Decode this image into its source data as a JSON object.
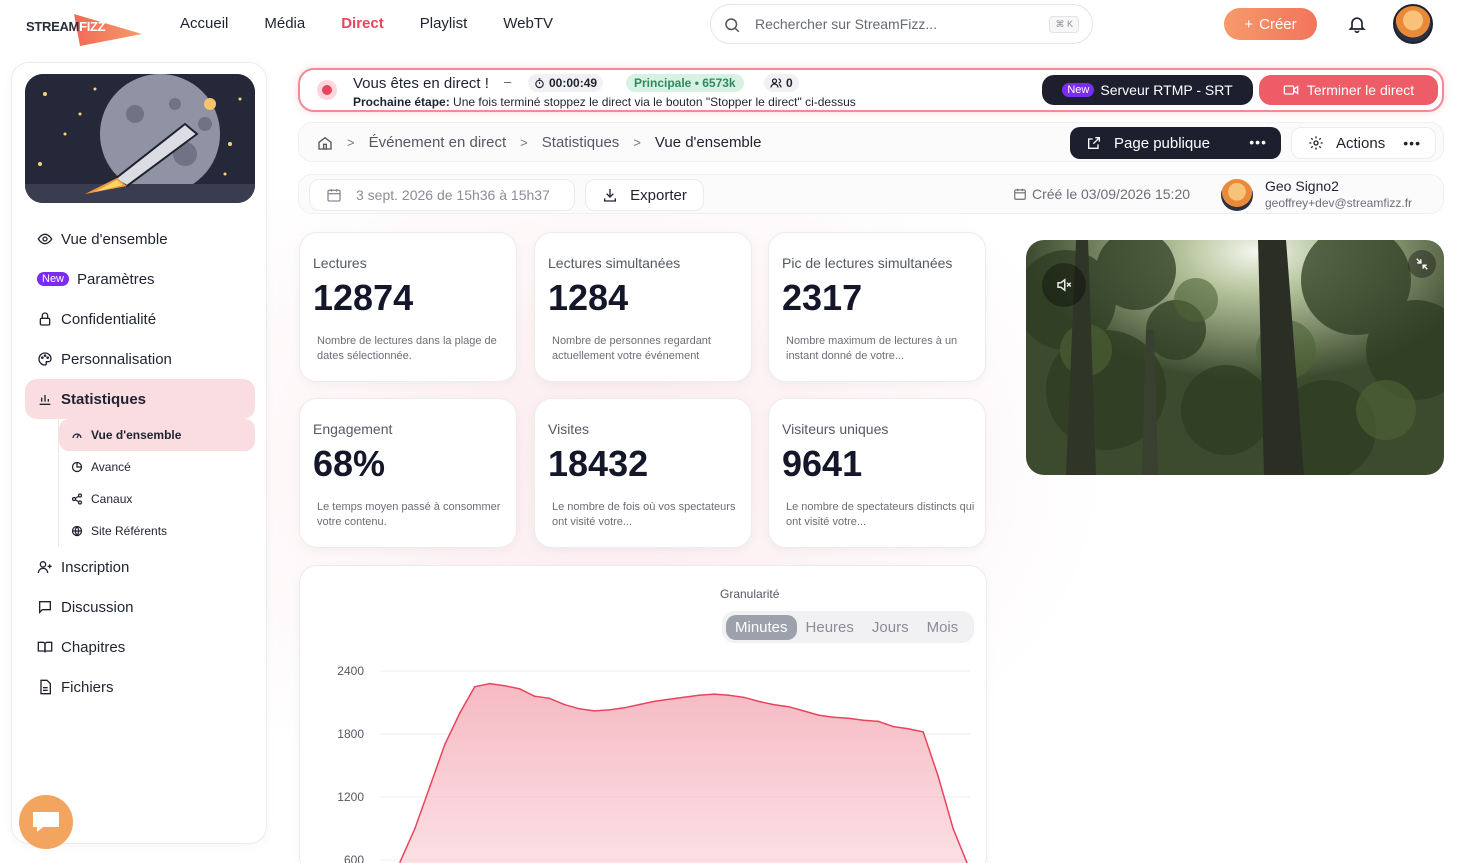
{
  "brand": {
    "logo_part1": "STREAM",
    "logo_part2": "FIZZ"
  },
  "nav": {
    "items": [
      {
        "label": "Accueil",
        "active": false
      },
      {
        "label": "Média",
        "active": false
      },
      {
        "label": "Direct",
        "active": true
      },
      {
        "label": "Playlist",
        "active": false
      },
      {
        "label": "WebTV",
        "active": false
      }
    ]
  },
  "search": {
    "placeholder": "Rechercher sur StreamFizz...",
    "shortcut": "⌘ K"
  },
  "create_button": {
    "label": "Créer"
  },
  "sidebar": {
    "items": [
      {
        "label": "Vue d'ensemble",
        "icon": "eye-icon"
      },
      {
        "label": "Paramètres",
        "icon": "",
        "badge": "New"
      },
      {
        "label": "Confidentialité",
        "icon": "lock-icon"
      },
      {
        "label": "Personnalisation",
        "icon": "palette-icon"
      },
      {
        "label": "Statistiques",
        "icon": "bar-chart-icon",
        "active": true
      }
    ],
    "subitems": [
      {
        "label": "Vue d'ensemble",
        "icon": "gauge-icon",
        "active": true
      },
      {
        "label": "Avancé",
        "icon": "pie-icon"
      },
      {
        "label": "Canaux",
        "icon": "share-icon"
      },
      {
        "label": "Site Référents",
        "icon": "globe-icon"
      }
    ],
    "items_after": [
      {
        "label": "Inscription",
        "icon": "user-plus-icon"
      },
      {
        "label": "Discussion",
        "icon": "chat-icon"
      },
      {
        "label": "Chapitres",
        "icon": "book-icon"
      },
      {
        "label": "Fichiers",
        "icon": "file-icon"
      }
    ]
  },
  "live": {
    "title": "Vous êtes en direct !",
    "dash": "–",
    "timer": "00:00:49",
    "main_label": "Principale • 6573k",
    "viewers": "0",
    "next_label": "Prochaine étape:",
    "next_text": "Une fois terminé stoppez le direct via le bouton \"Stopper le direct\" ci-dessus",
    "rtmp_badge": "New",
    "rtmp_label": "Serveur RTMP - SRT",
    "end_label": "Terminer le direct"
  },
  "breadcrumb": {
    "items": [
      "Événement en direct",
      "Statistiques",
      "Vue d'ensemble"
    ]
  },
  "public_button": {
    "label": "Page publique"
  },
  "actions_button": {
    "label": "Actions"
  },
  "daterow": {
    "range": "3 sept. 2026 de 15h36 à 15h37",
    "export_label": "Exporter",
    "created": "Créé le 03/09/2026 15:20",
    "author_name": "Geo Signo2",
    "author_email": "geoffrey+dev@streamfizz.fr"
  },
  "stats": [
    {
      "label": "Lectures",
      "value": "12874",
      "desc": "Nombre de lectures dans la plage de dates sélectionnée."
    },
    {
      "label": "Lectures simultanées",
      "value": "1284",
      "desc": "Nombre de personnes regardant actuellement votre événement"
    },
    {
      "label": "Pic de lectures simultanées",
      "value": "2317",
      "desc": "Nombre maximum de lectures à un instant donné de votre..."
    },
    {
      "label": "Engagement",
      "value": "68%",
      "desc": "Le temps moyen passé à consommer votre contenu."
    },
    {
      "label": "Visites",
      "value": "18432",
      "desc": "Le nombre de fois où vos spectateurs ont visité votre..."
    },
    {
      "label": "Visiteurs uniques",
      "value": "9641",
      "desc": "Le nombre de spectateurs distincts qui ont visité votre..."
    }
  ],
  "granularity": {
    "label": "Granularité",
    "options": [
      {
        "label": "Minutes",
        "active": true
      },
      {
        "label": "Heures",
        "active": false
      },
      {
        "label": "Jours",
        "active": false
      },
      {
        "label": "Mois",
        "active": false
      }
    ]
  },
  "colors": {
    "accent": "#e8455e",
    "dark": "#1d1f2e",
    "area_fill": "#f6b6c0",
    "area_line": "#e8455e"
  },
  "chart_data": {
    "type": "area",
    "yticks": [
      2400,
      1800,
      1200,
      600
    ],
    "ylim": [
      600,
      2400
    ],
    "values": [
      580,
      900,
      1300,
      1700,
      2000,
      2250,
      2280,
      2260,
      2230,
      2160,
      2140,
      2080,
      2040,
      2020,
      2030,
      2050,
      2080,
      2110,
      2130,
      2150,
      2170,
      2180,
      2170,
      2150,
      2110,
      2080,
      2060,
      2020,
      1980,
      1960,
      1950,
      1930,
      1920,
      1870,
      1850,
      1820,
      1400,
      900,
      550
    ]
  }
}
